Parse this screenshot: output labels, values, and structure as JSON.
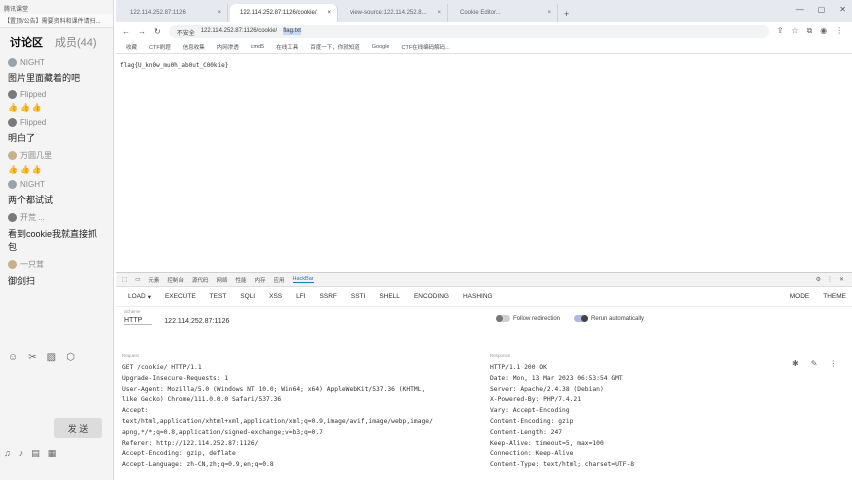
{
  "chat": {
    "top_title": "腾讯课堂",
    "notice": "【置顶/公告】需要资料和课件请扫...",
    "tabs": [
      {
        "label": "讨论区"
      },
      {
        "label": "成员(44)"
      }
    ],
    "messages": [
      {
        "user": "NIGHT",
        "text": "图片里面藏着的吧"
      },
      {
        "user": "Flipped",
        "text": "👍👍👍"
      },
      {
        "user": "Flipped",
        "text": "明白了"
      },
      {
        "user": "万圆几里",
        "text": "👍👍👍"
      },
      {
        "user": "NIGHT",
        "text": "两个都试试"
      },
      {
        "user": "开荒 ...",
        "text": "看到cookie我就直接抓包"
      },
      {
        "user": "一只茸",
        "text": "御剑扫"
      }
    ],
    "tools": [
      "☺",
      "✂",
      "▨",
      "⬡"
    ],
    "send_label": "发 送",
    "bottom_icons": [
      "♫",
      "♪",
      "▤",
      "▦"
    ]
  },
  "browser": {
    "tabs": [
      {
        "title": "122.114.252.87:1126"
      },
      {
        "title": "122.114.252.87:1126/cookie/"
      },
      {
        "title": "view-source:122.114.252.8..."
      },
      {
        "title": "Cookie Editor..."
      }
    ],
    "address_prefix": "不安全",
    "address": "122.114.252.87:1126/cookie/",
    "address_selected": "flag.txt",
    "bookmarks": [
      "收藏",
      "CTF刷题",
      "信息收集",
      "内网渗透",
      "cmd5",
      "在线工具",
      "百度一下，你就知道",
      "Google",
      "CTF在线编码解码..."
    ],
    "page_flag": "flag{U_kn0w_mu0h_ab0ut_C00kie}"
  },
  "devtools": {
    "tabs": [
      "元素",
      "控制台",
      "源代码",
      "网络",
      "性能",
      "内存",
      "应用",
      "HackBar"
    ],
    "active_tab": "HackBar",
    "hackbar_menu": [
      "LOAD",
      "EXECUTE",
      "TEST",
      "SQLI",
      "XSS",
      "LFI",
      "SSRF",
      "SSTI",
      "SHELL",
      "ENCODING",
      "HASHING"
    ],
    "hackbar_right": [
      "MODE",
      "THEME"
    ],
    "scheme_label": "Scheme",
    "scheme_value": "HTTP",
    "url_value": "122.114.252.87:1126",
    "follow_label": "Follow redirection",
    "rerun_label": "Rerun automatically",
    "request_label": "Request",
    "response_label": "Response",
    "request_lines": [
      "GET /cookie/ HTTP/1.1",
      "Upgrade-Insecure-Requests: 1",
      "User-Agent: Mozilla/5.0 (Windows NT 10.0; Win64; x64) AppleWebKit/537.36 (KHTML,",
      "like Gecko) Chrome/111.0.0.0 Safari/537.36",
      "Accept:",
      "text/html,application/xhtml+xml,application/xml;q=0.9,image/avif,image/webp,image/",
      "apng,*/*;q=0.8,application/signed-exchange;v=b3;q=0.7",
      "Referer: http://122.114.252.87:1126/",
      "Accept-Encoding: gzip, deflate",
      "Accept-Language: zh-CN,zh;q=0.9,en;q=0.8"
    ],
    "response_lines": [
      "HTTP/1.1 200 OK",
      "Date: Mon, 13 Mar 2023 06:53:54 GMT",
      "Server: Apache/2.4.38 (Debian)",
      "X-Powered-By: PHP/7.4.21",
      "Vary: Accept-Encoding",
      "Content-Encoding: gzip",
      "Content-Length: 247",
      "Keep-Alive: timeout=5, max=100",
      "Connection: Keep-Alive",
      "Content-Type: text/html; charset=UTF-8"
    ]
  }
}
